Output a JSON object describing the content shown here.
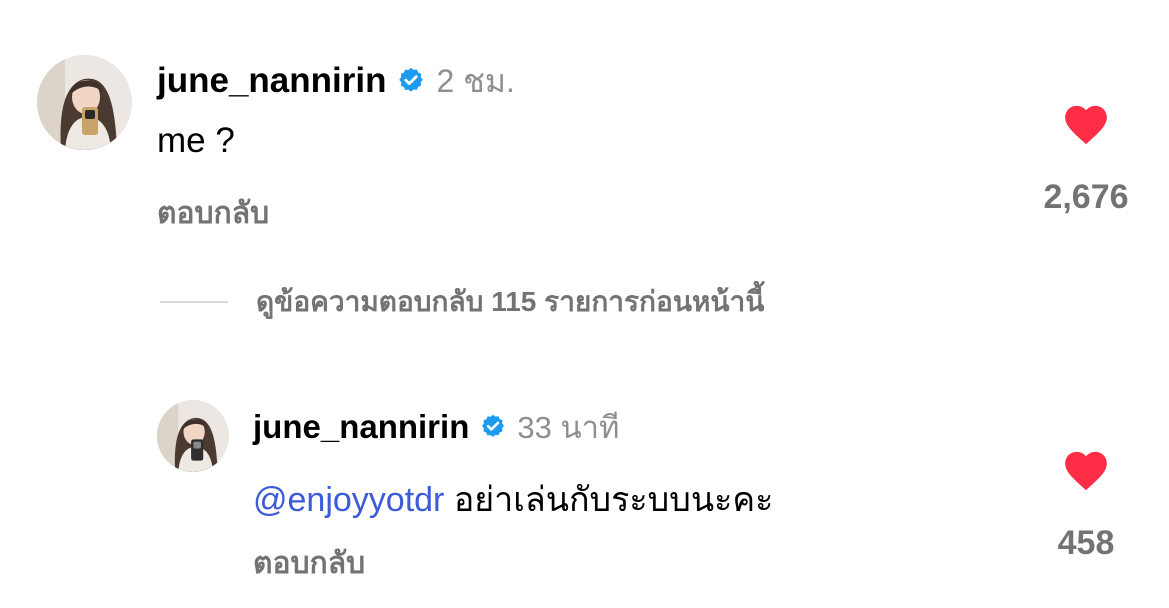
{
  "comments": [
    {
      "username": "june_nannirin",
      "timestamp": "2 ชม.",
      "text": "me ?",
      "reply_label": "ตอบกลับ",
      "like_count": "2,676",
      "liked": true,
      "verified": true
    }
  ],
  "view_replies": {
    "label": "ดูข้อความตอบกลับ 115 รายการก่อนหน้านี้"
  },
  "replies": [
    {
      "username": "june_nannirin",
      "timestamp": "33 นาที",
      "mention": "@enjoyyotdr",
      "text": " อย่าเล่นกับระบบนะคะ",
      "reply_label": "ตอบกลับ",
      "like_count": "458",
      "liked": true,
      "verified": true
    }
  ],
  "colors": {
    "heart": "#ff2d45",
    "verified_badge": "#1d9bf0",
    "mention": "#3b5bdb",
    "muted": "#737373",
    "timestamp": "#8e8e93"
  },
  "icons": {
    "like": "heart-filled-icon",
    "verified": "verified-badge-icon"
  }
}
